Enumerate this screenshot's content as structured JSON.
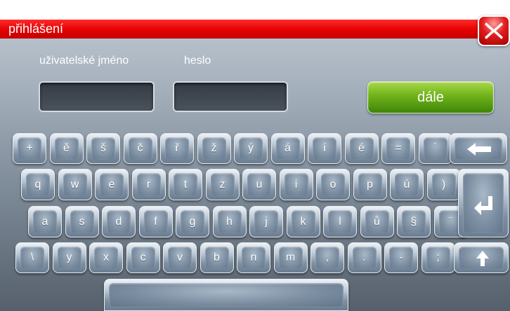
{
  "window": {
    "title": "přihlášení"
  },
  "login": {
    "username_label": "uživatelské jméno",
    "password_label": "heslo",
    "username_value": "",
    "password_value": "",
    "next_label": "dále"
  },
  "keyboard": {
    "row1": [
      "+",
      "ě",
      "š",
      "č",
      "ř",
      "ž",
      "ý",
      "á",
      "í",
      "é",
      "=",
      "´"
    ],
    "row2": [
      "q",
      "w",
      "e",
      "r",
      "t",
      "z",
      "u",
      "i",
      "o",
      "p",
      "ú",
      ")"
    ],
    "row3": [
      "a",
      "s",
      "d",
      "f",
      "g",
      "h",
      "j",
      "k",
      "l",
      "ů",
      "§",
      "¨"
    ],
    "row4": [
      "\\",
      "y",
      "x",
      "c",
      "v",
      "b",
      "n",
      "m",
      ",",
      ".",
      "-",
      ";"
    ],
    "special": {
      "backspace_icon": "arrow-left-icon",
      "enter_icon": "enter-arrow-icon",
      "shift_icon": "arrow-up-icon",
      "close_icon": "close-x-icon"
    }
  },
  "colors": {
    "titlebar": "#e30000",
    "next_button": "#6fb21a",
    "key": "#8a9bb0"
  }
}
